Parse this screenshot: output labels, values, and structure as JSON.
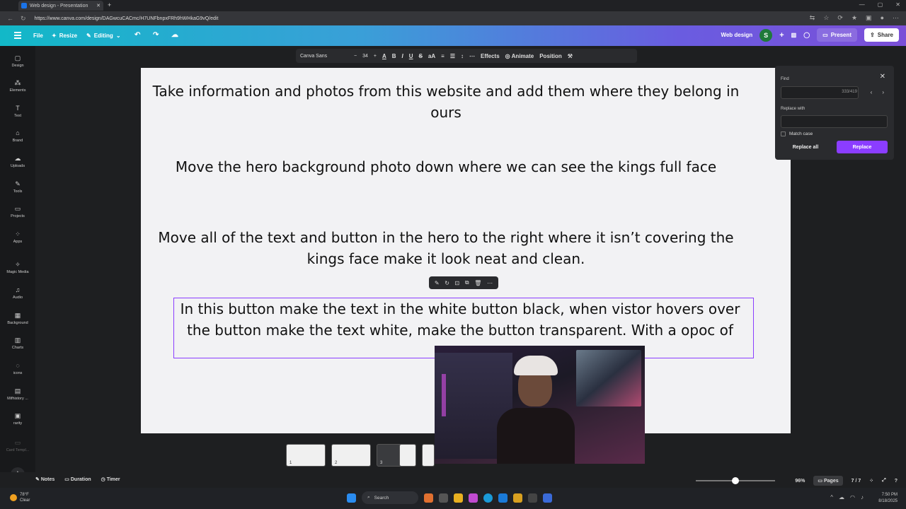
{
  "browser": {
    "tab_title": "Web design - Presentation",
    "url": "https://www.canva.com/design/DAGwcuCACmc/H7UNFbnpxFRh9hWHkaG9vQ/edit"
  },
  "topbar": {
    "file_label": "File",
    "resize_label": "Resize",
    "editing_label": "Editing",
    "design_name": "Web design",
    "avatar_letter": "S",
    "present_label": "Present",
    "share_label": "Share"
  },
  "sidebar": {
    "items": [
      {
        "label": "Design",
        "icon": "design-icon"
      },
      {
        "label": "Elements",
        "icon": "elements-icon"
      },
      {
        "label": "Text",
        "icon": "text-icon"
      },
      {
        "label": "Brand",
        "icon": "brand-icon"
      },
      {
        "label": "Uploads",
        "icon": "uploads-icon"
      },
      {
        "label": "Tools",
        "icon": "tools-icon"
      },
      {
        "label": "Projects",
        "icon": "projects-icon"
      },
      {
        "label": "Apps",
        "icon": "apps-icon"
      },
      {
        "label": "Magic Media",
        "icon": "magic-media-icon"
      },
      {
        "label": "Audio",
        "icon": "audio-icon"
      },
      {
        "label": "Background",
        "icon": "background-icon"
      },
      {
        "label": "Charts",
        "icon": "charts-icon"
      },
      {
        "label": "icons",
        "icon": "icons-icon"
      },
      {
        "label": "Mifhistory ...",
        "icon": "mifhistory-icon"
      },
      {
        "label": "rarity",
        "icon": "rarity-icon"
      },
      {
        "label": "Card Templ...",
        "icon": "card-templates-icon"
      }
    ]
  },
  "toolbar": {
    "font_family": "Canva Sans",
    "font_size": "34",
    "effects_label": "Effects",
    "animate_label": "Animate",
    "position_label": "Position"
  },
  "canvas": {
    "paragraphs": [
      "Take information and  photos from this website  and add them where they belong in ours",
      "Move the hero background photo down where we can see the kings full face",
      "Move all of the text and button in the hero to the right where it isn’t covering the kings face make it look neat and clean.",
      "In this button make the text in the white button black, when vistor hovers over the button make the text white, make the button transparent. With a opoc of"
    ]
  },
  "find_panel": {
    "find_label": "Find",
    "count": "333/419",
    "replace_label": "Replace with",
    "match_case_label": "Match case",
    "replace_all_label": "Replace all",
    "replace_button_label": "Replace"
  },
  "thumbnails": [
    {
      "num": "1"
    },
    {
      "num": "2"
    },
    {
      "num": "3"
    }
  ],
  "bottombar": {
    "notes_label": "Notes",
    "duration_label": "Duration",
    "timer_label": "Timer",
    "zoom": "96%",
    "zoom_fraction": 0.5,
    "pages_label": "Pages",
    "page_count": "7 / 7"
  },
  "taskbar": {
    "temperature": "78°F",
    "weather": "Clear",
    "search_label": "Search",
    "time": "7:50 PM",
    "date": "8/18/2025"
  },
  "colors": {
    "accent": "#8b3dff"
  }
}
